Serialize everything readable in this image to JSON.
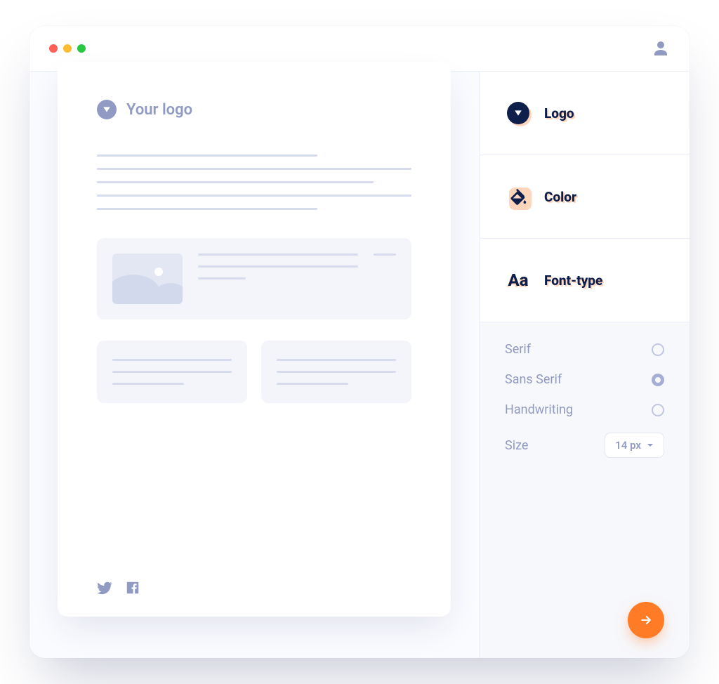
{
  "preview": {
    "logo_placeholder": "Your logo"
  },
  "panel": {
    "sections": {
      "logo": "Logo",
      "color": "Color",
      "font": "Font-type"
    }
  },
  "font_options": {
    "items": [
      {
        "label": "Serif",
        "selected": false
      },
      {
        "label": "Sans Serif",
        "selected": true
      },
      {
        "label": "Handwriting",
        "selected": false
      }
    ],
    "size_label": "Size",
    "size_value": "14 px"
  },
  "colors": {
    "accent": "#ff7b25",
    "navy": "#0f1f4b",
    "muted": "#919ac2"
  }
}
